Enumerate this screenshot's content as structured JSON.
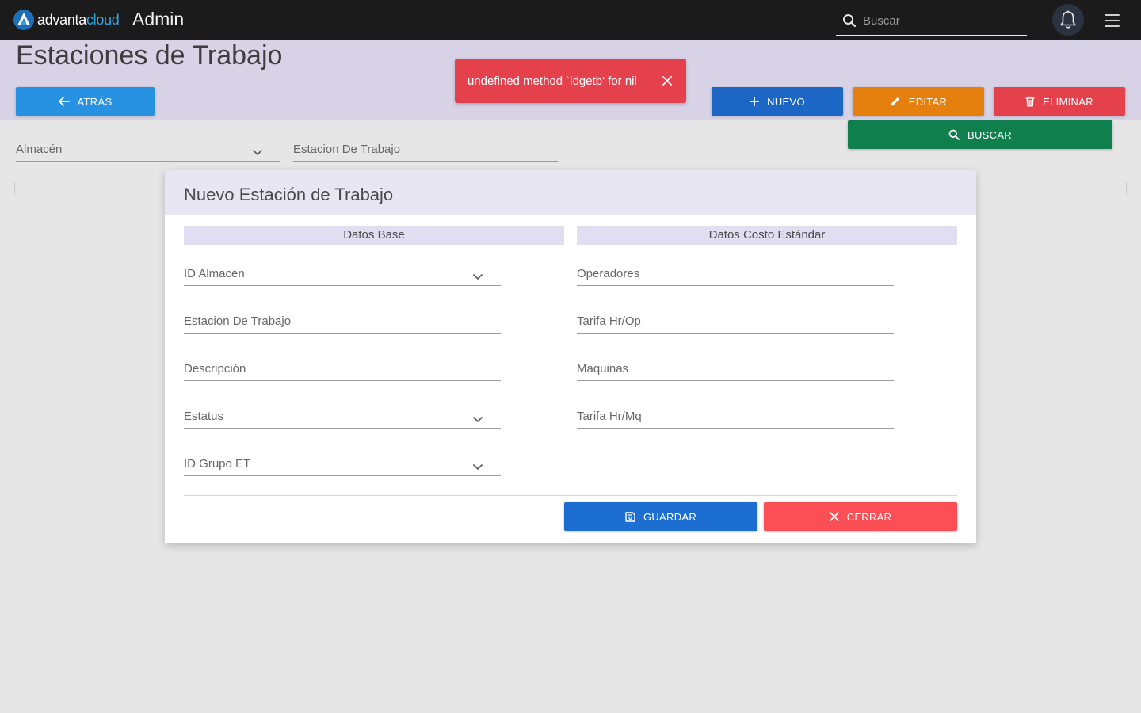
{
  "brand": {
    "logo_prefix": "advanta",
    "logo_suffix": "cloud",
    "app_title": "Admin"
  },
  "topbar": {
    "search_placeholder": "Buscar",
    "icons": [
      "search-icon",
      "bell-icon",
      "hamburger-menu-icon"
    ]
  },
  "page": {
    "title": "Estaciones de Trabajo"
  },
  "toolbar": {
    "back_label": "ATRÁS",
    "new_label": "NUEVO",
    "edit_label": "EDITAR",
    "delete_label": "ELIMINAR",
    "search_label": "BUSCAR"
  },
  "toast": {
    "message": "undefined method `idgetb' for nil"
  },
  "filters": {
    "almacen_label": "Almacén",
    "estacion_label": "Estacion De Trabajo"
  },
  "modal": {
    "title": "Nuevo Estación de Trabajo",
    "section_base": "Datos Base",
    "section_costo": "Datos Costo Estándar",
    "fields_base": {
      "id_almacen": "ID Almacén",
      "estacion": "Estacion De Trabajo",
      "descripcion": "Descripción",
      "estatus": "Estatus",
      "id_grupo": "ID Grupo ET"
    },
    "fields_costo": {
      "operadores": "Operadores",
      "tarifa_op": "Tarifa Hr/Op",
      "maquinas": "Maquinas",
      "tarifa_mq": "Tarifa Hr/Mq"
    },
    "save_label": "GUARDAR",
    "close_label": "CERRAR"
  },
  "colors": {
    "topbar": "#1b1b1b",
    "header_band": "#d7d2e6",
    "primary_blue": "#1c67c5",
    "light_blue": "#2791e2",
    "orange": "#e5800f",
    "red": "#e5414d",
    "green": "#0f7f4e",
    "close_red": "#fc4e55"
  }
}
